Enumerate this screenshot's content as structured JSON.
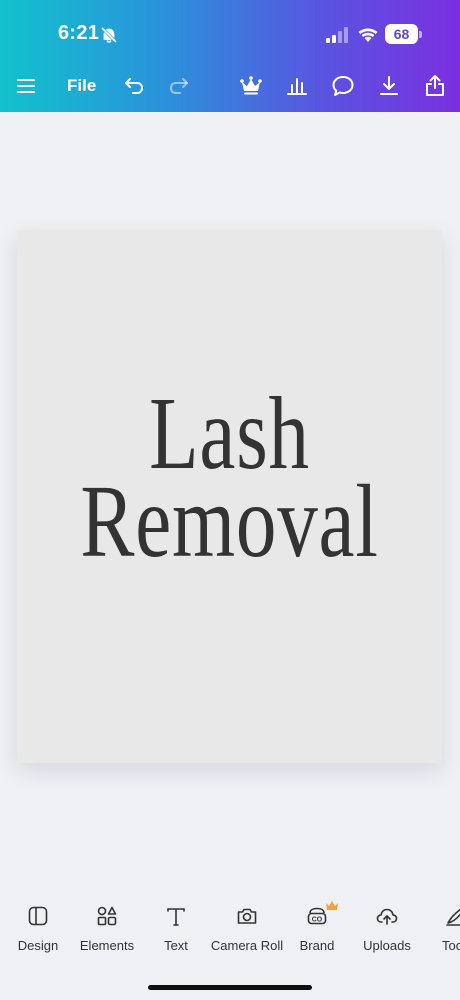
{
  "status_bar": {
    "time": "6:21",
    "battery": "68"
  },
  "toolbar": {
    "file_label": "File",
    "icons": [
      "menu-icon",
      "undo-icon",
      "redo-icon",
      "crown-icon",
      "chart-icon",
      "comment-icon",
      "download-icon",
      "share-icon"
    ]
  },
  "canvas": {
    "line1": "Lash",
    "line2": "Removal",
    "background": "#e8e8e8",
    "text_color": "#333333"
  },
  "bottom_tabs": [
    {
      "label": "Design",
      "icon": "design-icon"
    },
    {
      "label": "Elements",
      "icon": "elements-icon"
    },
    {
      "label": "Text",
      "icon": "text-icon"
    },
    {
      "label": "Camera Roll",
      "icon": "camera-icon"
    },
    {
      "label": "Brand",
      "icon": "brand-icon"
    },
    {
      "label": "Uploads",
      "icon": "upload-icon"
    },
    {
      "label": "Too",
      "icon": "tools-icon"
    }
  ],
  "colors": {
    "gradient_start": "#12c2cc",
    "gradient_end": "#7b2fe0",
    "crown": "#f2a33a"
  }
}
